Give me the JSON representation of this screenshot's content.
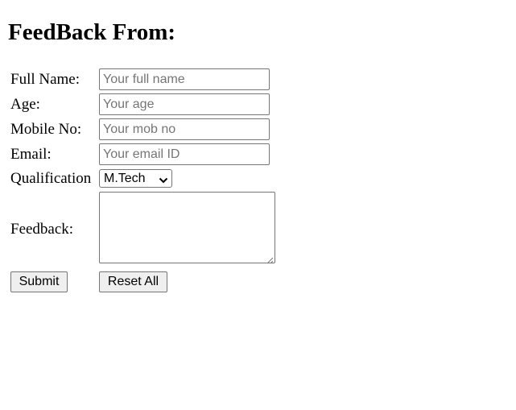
{
  "page": {
    "title": "FeedBack From:"
  },
  "form": {
    "full_name": {
      "label": "Full Name:",
      "placeholder": "Your full name",
      "value": ""
    },
    "age": {
      "label": "Age:",
      "placeholder": "Your age",
      "value": ""
    },
    "mobile": {
      "label": "Mobile No:",
      "placeholder": "Your mob no",
      "value": ""
    },
    "email": {
      "label": "Email:",
      "placeholder": "Your email ID",
      "value": ""
    },
    "qualification": {
      "label": "Qualification",
      "selected": "M.Tech"
    },
    "feedback": {
      "label": "Feedback:",
      "value": ""
    }
  },
  "buttons": {
    "submit_label": "Submit",
    "reset_label": "Reset All"
  },
  "icons": {
    "select_arrow": "chevron-down-icon",
    "textarea_resize": "resize-grip-icon"
  }
}
